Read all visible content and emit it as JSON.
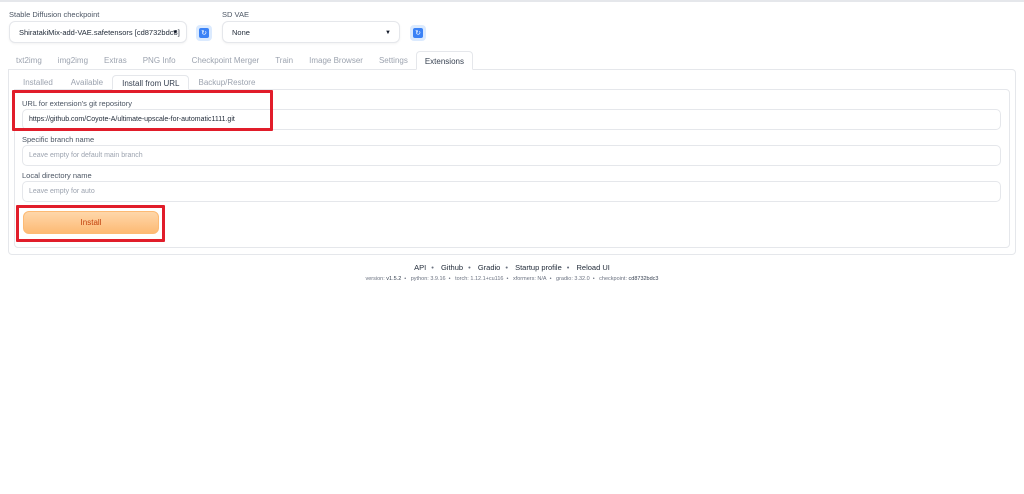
{
  "checkpoint": {
    "label": "Stable Diffusion checkpoint",
    "value": "ShiratakiMix-add-VAE.safetensors [cd8732bdc3]"
  },
  "vae": {
    "label": "SD VAE",
    "value": "None"
  },
  "tabs": [
    {
      "label": "txt2img",
      "active": false
    },
    {
      "label": "img2img",
      "active": false
    },
    {
      "label": "Extras",
      "active": false
    },
    {
      "label": "PNG Info",
      "active": false
    },
    {
      "label": "Checkpoint Merger",
      "active": false
    },
    {
      "label": "Train",
      "active": false
    },
    {
      "label": "Image Browser",
      "active": false
    },
    {
      "label": "Settings",
      "active": false
    },
    {
      "label": "Extensions",
      "active": true
    }
  ],
  "subtabs": [
    {
      "label": "Installed",
      "active": false
    },
    {
      "label": "Available",
      "active": false
    },
    {
      "label": "Install from URL",
      "active": true
    },
    {
      "label": "Backup/Restore",
      "active": false
    }
  ],
  "form": {
    "url": {
      "label": "URL for extension's git repository",
      "value": "https://github.com/Coyote-A/ultimate-upscale-for-automatic1111.git"
    },
    "branch": {
      "label": "Specific branch name",
      "placeholder": "Leave empty for default main branch"
    },
    "directory": {
      "label": "Local directory name",
      "placeholder": "Leave empty for auto"
    },
    "install_label": "Install"
  },
  "footer": {
    "links": [
      "API",
      "Github",
      "Gradio",
      "Startup profile",
      "Reload UI"
    ],
    "versions": [
      {
        "key": "version:",
        "value": "v1.5.2"
      },
      {
        "key": "python:",
        "value": "3.9.16"
      },
      {
        "key": "torch:",
        "value": "1.12.1+cu116"
      },
      {
        "key": "xformers:",
        "value": "N/A"
      },
      {
        "key": "gradio:",
        "value": "3.32.0"
      },
      {
        "key": "checkpoint:",
        "value": "cd8732bdc3"
      }
    ]
  },
  "colors": {
    "accent": "#3b82f6",
    "install": "#fdba74",
    "highlight": "#e11d2a"
  }
}
